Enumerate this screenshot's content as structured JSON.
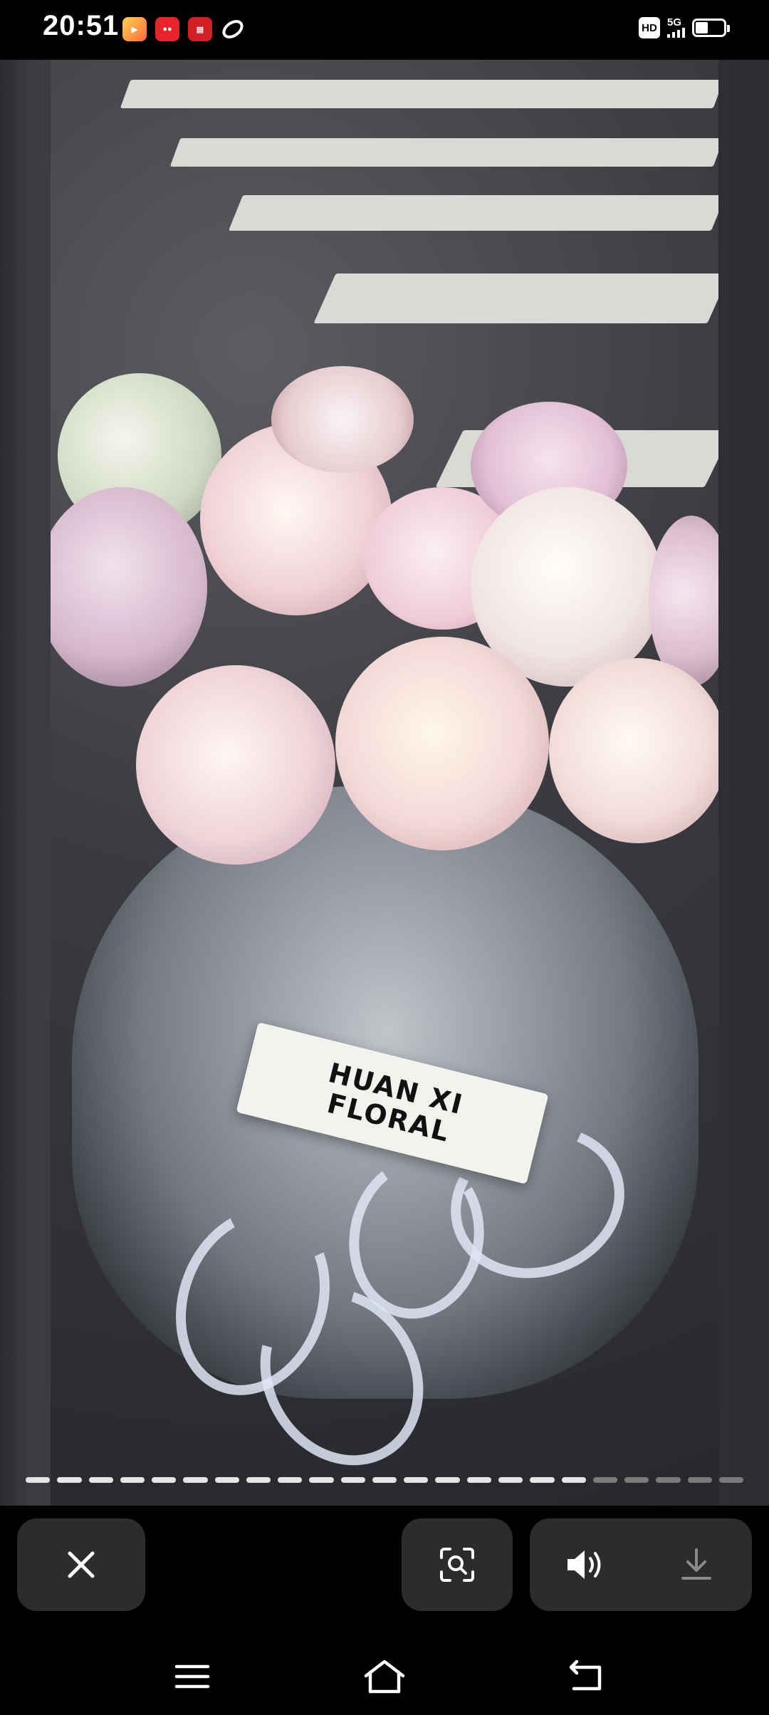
{
  "status_bar": {
    "time": "20:51",
    "hd_label": "HD",
    "network_label": "5G",
    "app_icons": [
      "video-app-icon",
      "red-app-icon",
      "news-app-icon",
      "swirl-app-icon"
    ]
  },
  "viewer": {
    "photo_label_line1": "HUAN XI",
    "photo_label_line2": "FLORAL",
    "progress": {
      "segments": 23,
      "active": 18
    }
  },
  "controls": {
    "close_icon": "close-icon",
    "scan_icon": "scan-icon",
    "volume_icon": "volume-icon",
    "download_icon": "download-icon"
  },
  "nav": {
    "items": [
      "menu-icon",
      "home-icon",
      "back-icon"
    ]
  },
  "colors": {
    "background": "#000000",
    "button": "#2c2c2e",
    "icon": "#ffffff"
  }
}
